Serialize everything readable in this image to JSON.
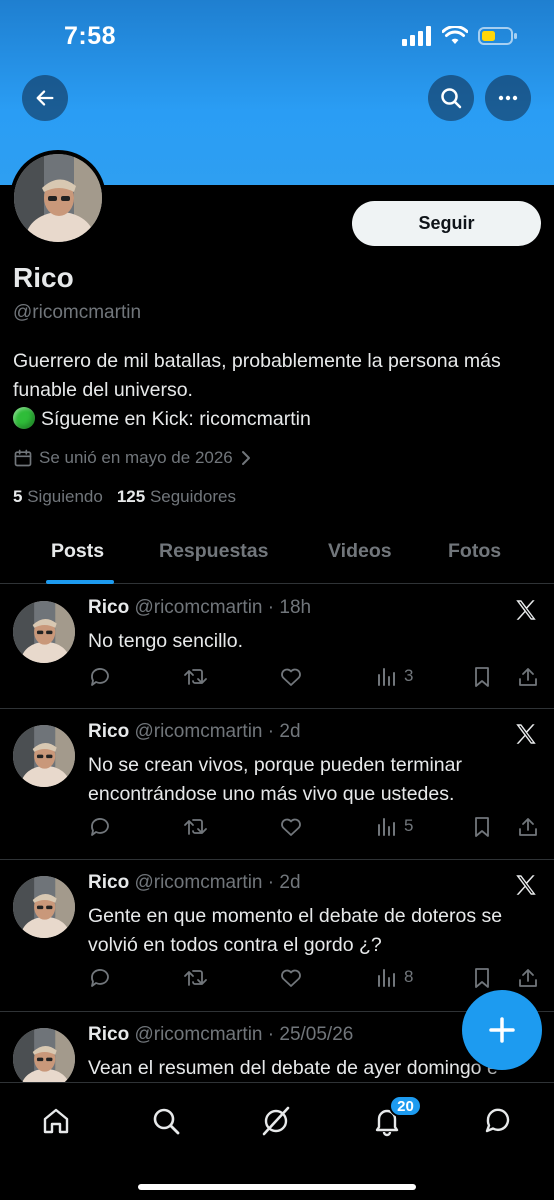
{
  "status_bar": {
    "time": "7:58"
  },
  "header": {
    "back_icon": "arrow-left-icon",
    "search_icon": "search-icon",
    "more_icon": "more-horizontal-icon"
  },
  "profile": {
    "name": "Rico",
    "handle": "@ricomcmartin",
    "follow_label": "Seguir",
    "bio_line1": "Guerrero de mil batallas, probablemente la persona más funable del universo.",
    "bio_line2": "Sígueme en Kick: ricomcmartin",
    "joined": "Se unió en mayo de 2026",
    "following_count": "5",
    "following_label": "Siguiendo",
    "followers_count": "125",
    "followers_label": "Seguidores"
  },
  "tabs": [
    {
      "label": "Posts",
      "active": true
    },
    {
      "label": "Respuestas",
      "active": false
    },
    {
      "label": "Videos",
      "active": false
    },
    {
      "label": "Fotos",
      "active": false
    }
  ],
  "tweets": [
    {
      "name": "Rico",
      "meta": "@ricomcmartin · 18h",
      "text": "No tengo sencillo.",
      "views": "3"
    },
    {
      "name": "Rico",
      "meta": "@ricomcmartin · 2d",
      "text": "No se crean vivos, porque pueden terminar encontrándose uno más vivo que ustedes.",
      "views": "5"
    },
    {
      "name": "Rico",
      "meta": "@ricomcmartin · 2d",
      "text": "Gente en que momento el debate de doteros se volvió en todos contra el gordo ¿?",
      "views": "8"
    },
    {
      "name": "Rico",
      "meta": "@ricomcmartin · 25/05/26",
      "text": "Vean el resumen del debate de ayer domingo e"
    }
  ],
  "bottom_nav": {
    "notifications_badge": "20"
  },
  "colors": {
    "accent": "#1d9bf0",
    "banner": "#2a9df4",
    "background": "#000000",
    "muted": "#71767b"
  }
}
